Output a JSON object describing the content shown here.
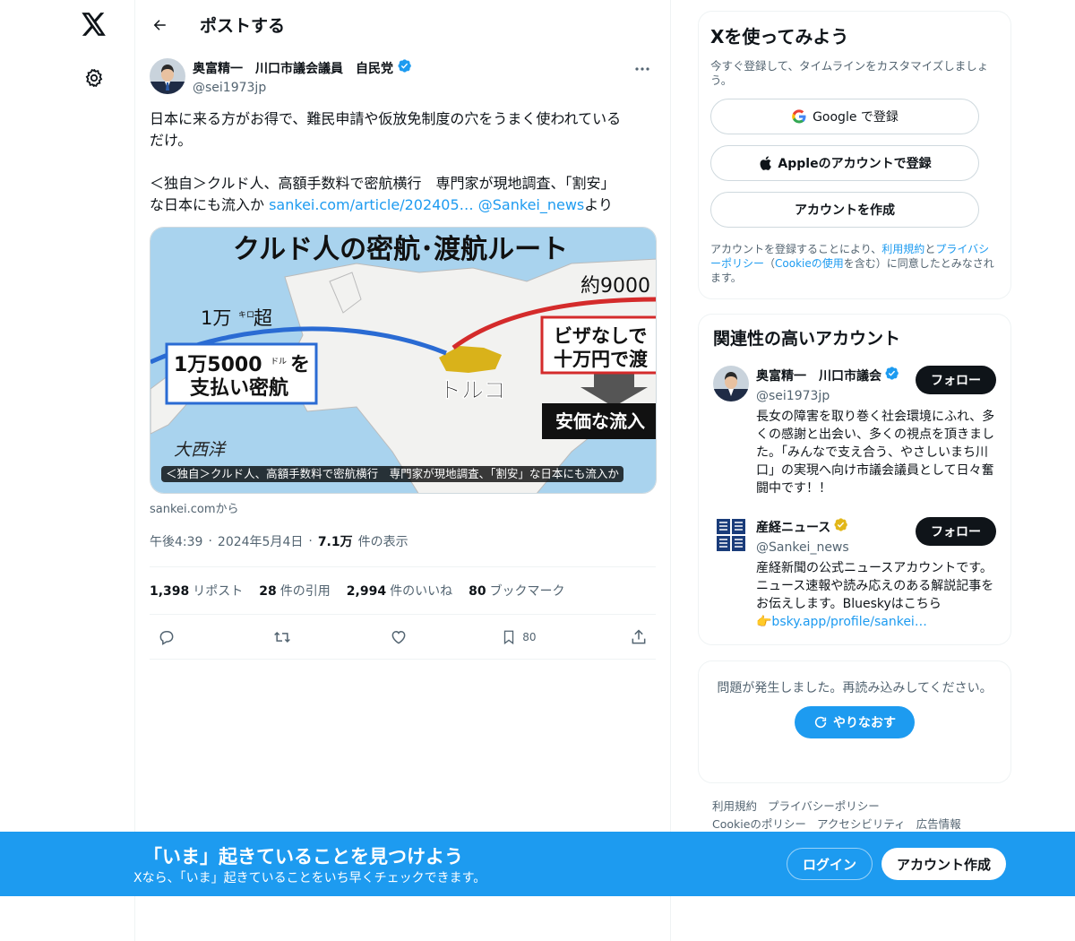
{
  "nav": {
    "logo_icon": "x-logo-icon",
    "settings_icon": "gear-icon"
  },
  "header": {
    "title": "ポストする"
  },
  "tweet": {
    "author_name": "奥富精一　川口市議会議員　自民党",
    "author_handle": "@sei1973jp",
    "text_line1": "日本に来る方がお得で、難民申請や仮放免制度の穴をうまく使われている",
    "text_line2": "だけ。",
    "text_line3": "＜独自＞クルド人、高額手数料で密航横行　専門家が現地調査、「割安」",
    "text_line4_prefix": "な日本にも流入か ",
    "link_article": "sankei.com/article/202405…",
    "link_mention": "@Sankei_news",
    "text_line4_suffix": "より",
    "card": {
      "image_title": "クルド人の密航･渡航ルート",
      "label_distance_left": "1万",
      "label_distance_left_unit": "キロ",
      "label_distance_left_suffix": "超",
      "label_distance_right": "約9000",
      "box_left_line1": "1万5000",
      "box_left_unit": "ドル",
      "box_left_line1_suffix": "を",
      "box_left_line2": "支払い密航",
      "box_right_line1": "ビザなしで",
      "box_right_line2": "十万円で渡",
      "box_cheap": "安価な流入",
      "label_turkey": "トルコ",
      "label_atlantic": "大西洋",
      "caption": "＜独自＞クルド人、高額手数料で密航横行　専門家が現地調査、「割安」な日本にも流入か"
    },
    "source": "sankei.comから",
    "time": "午後4:39",
    "date": "2024年5月4日",
    "views_count": "7.1万",
    "views_label": "件の表示",
    "stats": {
      "reposts_count": "1,398",
      "reposts_label": "リポスト",
      "quotes_count": "28",
      "quotes_label": "件の引用",
      "likes_count": "2,994",
      "likes_label": "件のいいね",
      "bookmarks_count": "80",
      "bookmarks_label": "ブックマーク"
    },
    "bookmark_action_count": "80"
  },
  "signup": {
    "title": "Xを使ってみよう",
    "subtitle": "今すぐ登録して、タイムラインをカスタマイズしましょう。",
    "google_label": "Google で登録",
    "apple_label": "Appleのアカウントで登録",
    "create_label": "アカウントを作成",
    "legal_prefix": "アカウントを登録することにより、",
    "legal_terms": "利用規約",
    "legal_and": "と",
    "legal_privacy": "プライバシーポリシー",
    "legal_open": "（",
    "legal_cookie": "Cookieの使用",
    "legal_suffix": "を含む）に同意したとみなされます。"
  },
  "related": {
    "title": "関連性の高いアカウント",
    "accounts": [
      {
        "name": "奥富精一　川口市議会",
        "handle": "@sei1973jp",
        "bio": "長女の障害を取り巻く社会環境にふれ、多くの感謝と出会い、多くの視点を頂きました。「みんなで支え合う、やさしいまち川口」の実現へ向け市議会議員として日々奮闘中です！！",
        "follow": "フォロー"
      },
      {
        "name": "産経ニュース",
        "handle": "@Sankei_news",
        "bio": "産経新聞の公式ニュースアカウントです。ニュース速報や読み応えのある解説記事をお伝えします。Blueskyはこちら",
        "bio_link": "👉bsky.app/profile/sankei…",
        "follow": "フォロー"
      }
    ]
  },
  "error": {
    "message": "問題が発生しました。再読み込みしてください。",
    "retry": "やりなおす"
  },
  "footer": {
    "terms": "利用規約",
    "privacy": "プライバシーポリシー",
    "cookie": "Cookieのポリシー",
    "accessibility": "アクセシビリティ",
    "ads": "広告情報"
  },
  "banner": {
    "title": "「いま」起きていることを見つけよう",
    "subtitle": "Xなら、「いま」起きていることをいち早くチェックできます。",
    "login": "ログイン",
    "create": "アカウント作成"
  },
  "colors": {
    "accent": "#1d9bf0",
    "text": "#0f1419",
    "secondary": "#536471",
    "verified_blue": "#1d9bf0",
    "verified_gold": "#e2b719"
  }
}
